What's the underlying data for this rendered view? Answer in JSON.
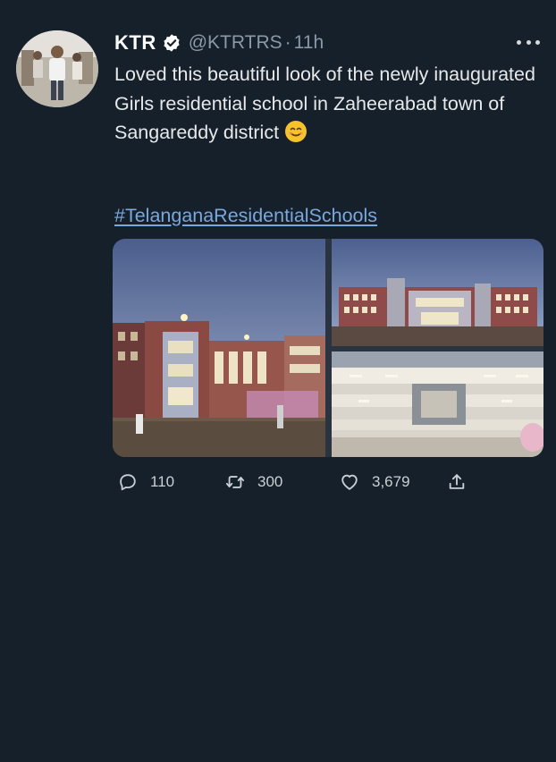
{
  "tweet": {
    "author_name": "KTR",
    "verified_icon": "verified-badge-icon",
    "handle": "@KTRTRS",
    "separator": "·",
    "time": "11h",
    "text": "Loved this beautiful look of the newly inaugurated Girls residential school in Zaheerabad town of Sangareddy district",
    "emoji_icon": "smiling-face-emoji",
    "hashtag": "#TelanganaResidentialSchools",
    "images": [
      "school-exterior-dusk-photo",
      "school-front-facade-photo",
      "school-courtyard-interior-photo"
    ],
    "replies": "110",
    "retweets": "300",
    "likes": "3,679"
  },
  "colors": {
    "background": "#15202b",
    "text": "#e7e9ea",
    "secondary_text": "#8b98a5",
    "link": "#7aa7dc"
  }
}
